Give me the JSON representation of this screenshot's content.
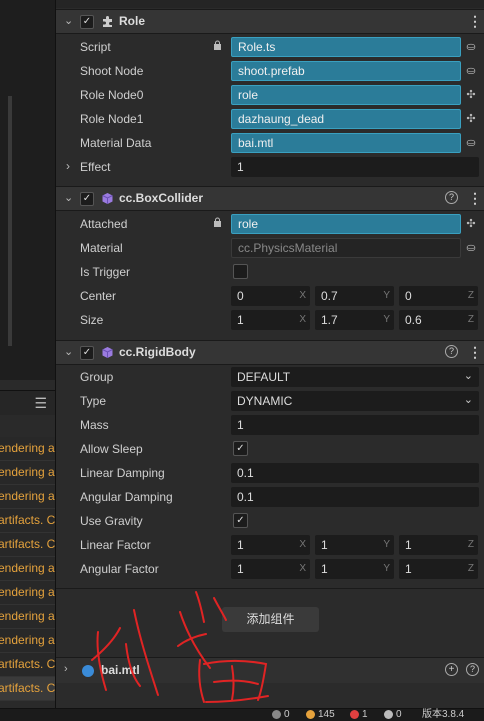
{
  "console": {
    "logs": [
      {
        "text": "endering a"
      },
      {
        "text": "endering a"
      },
      {
        "text": "endering a"
      },
      {
        "text": "artifacts. C"
      },
      {
        "text": "artifacts. C"
      },
      {
        "text": "endering a"
      },
      {
        "text": "endering a"
      },
      {
        "text": "endering a"
      },
      {
        "text": "endering a"
      },
      {
        "text": "artifacts. C"
      },
      {
        "text": "artifacts. C"
      }
    ],
    "menu_icon": "hamburger-icon"
  },
  "role": {
    "title": "Role",
    "icon": "puzzle-icon",
    "script_label": "Script",
    "script_value": "Role.ts",
    "shoot_label": "Shoot Node",
    "shoot_value": "shoot.prefab",
    "node0_label": "Role Node0",
    "node0_value": "role",
    "node1_label": "Role Node1",
    "node1_value": "dazhaung_dead",
    "material_label": "Material Data",
    "material_value": "bai.mtl",
    "effect_label": "Effect",
    "effect_value": "1"
  },
  "box": {
    "title": "cc.BoxCollider",
    "attached_label": "Attached",
    "attached_value": "role",
    "material_label": "Material",
    "material_value": "cc.PhysicsMaterial",
    "trigger_label": "Is Trigger",
    "center_label": "Center",
    "center": {
      "x": "0",
      "y": "0.7",
      "z": "0"
    },
    "size_label": "Size",
    "size": {
      "x": "1",
      "y": "1.7",
      "z": "0.6"
    }
  },
  "rigid": {
    "title": "cc.RigidBody",
    "group_label": "Group",
    "group_value": "DEFAULT",
    "type_label": "Type",
    "type_value": "DYNAMIC",
    "mass_label": "Mass",
    "mass_value": "1",
    "sleep_label": "Allow Sleep",
    "lin_damp_label": "Linear Damping",
    "lin_damp_value": "0.1",
    "ang_damp_label": "Angular Damping",
    "ang_damp_value": "0.1",
    "gravity_label": "Use Gravity",
    "lin_factor_label": "Linear Factor",
    "lin_factor": {
      "x": "1",
      "y": "1",
      "z": "1"
    },
    "ang_factor_label": "Angular Factor",
    "ang_factor": {
      "x": "1",
      "y": "1",
      "z": "1"
    }
  },
  "axes": {
    "x": "X",
    "y": "Y",
    "z": "Z"
  },
  "add_component": "添加组件",
  "material_section": {
    "title": "bai.mtl"
  },
  "status": {
    "s1": "0",
    "s2": "145",
    "s3": "1",
    "s4": "0",
    "version": "版本3.8.4"
  },
  "colors": {
    "asset_fill": "#2b7c99",
    "log_text": "#e5a23c",
    "annotation": "#e02424"
  }
}
